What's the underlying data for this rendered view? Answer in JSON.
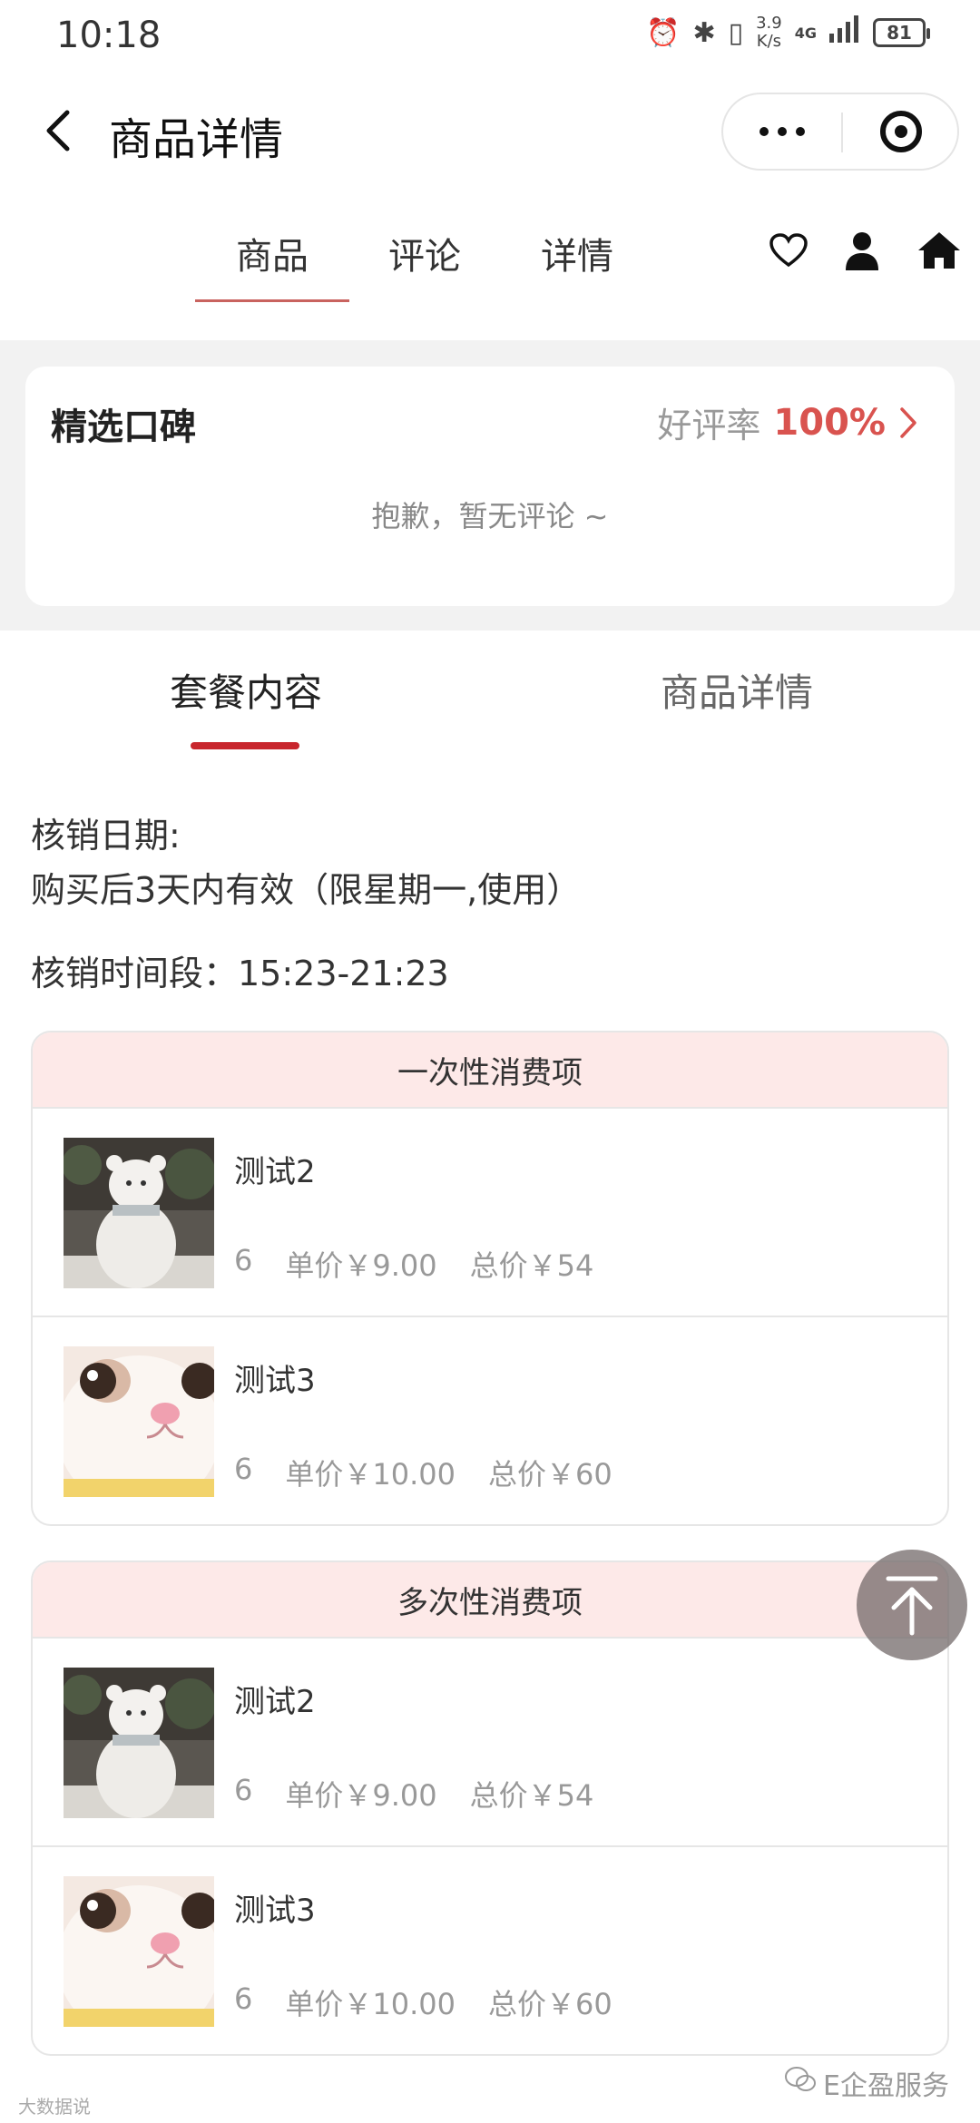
{
  "status": {
    "time": "10:18",
    "net_speed_value": "3.9",
    "net_speed_unit": "K/s",
    "network": "4G",
    "battery": "81"
  },
  "titlebar": {
    "title": "商品详情"
  },
  "tabs": [
    {
      "label": "商品",
      "active": true
    },
    {
      "label": "评论",
      "active": false
    },
    {
      "label": "详情",
      "active": false
    }
  ],
  "review": {
    "title": "精选口碑",
    "rating_label": "好评率",
    "rating_value": "100%",
    "empty_text": "抱歉，暂无评论 ~"
  },
  "section_tabs": [
    {
      "label": "套餐内容",
      "active": true
    },
    {
      "label": "商品详情",
      "active": false
    }
  ],
  "info": {
    "date_label": "核销日期:",
    "date_value": "购买后3天内有效（限星期一,使用）",
    "time_line": "核销时间段：15:23-21:23"
  },
  "packages": [
    {
      "heading": "一次性消费项",
      "items": [
        {
          "name": "测试2",
          "qty": "6",
          "unit_price": "单价￥9.00",
          "total": "总价￥54",
          "image": "snowman"
        },
        {
          "name": "测试3",
          "qty": "6",
          "unit_price": "单价￥10.00",
          "total": "总价￥60",
          "image": "cat"
        }
      ]
    },
    {
      "heading": "多次性消费项",
      "items": [
        {
          "name": "测试2",
          "qty": "6",
          "unit_price": "单价￥9.00",
          "total": "总价￥54",
          "image": "snowman"
        },
        {
          "name": "测试3",
          "qty": "6",
          "unit_price": "单价￥10.00",
          "total": "总价￥60",
          "image": "cat"
        }
      ]
    }
  ],
  "footer": {
    "left": "大数据说",
    "right": "E企盈服务"
  },
  "colors": {
    "accent": "#c8262d",
    "rating": "#d9534f",
    "pkg_header_bg": "#fde9e8"
  }
}
